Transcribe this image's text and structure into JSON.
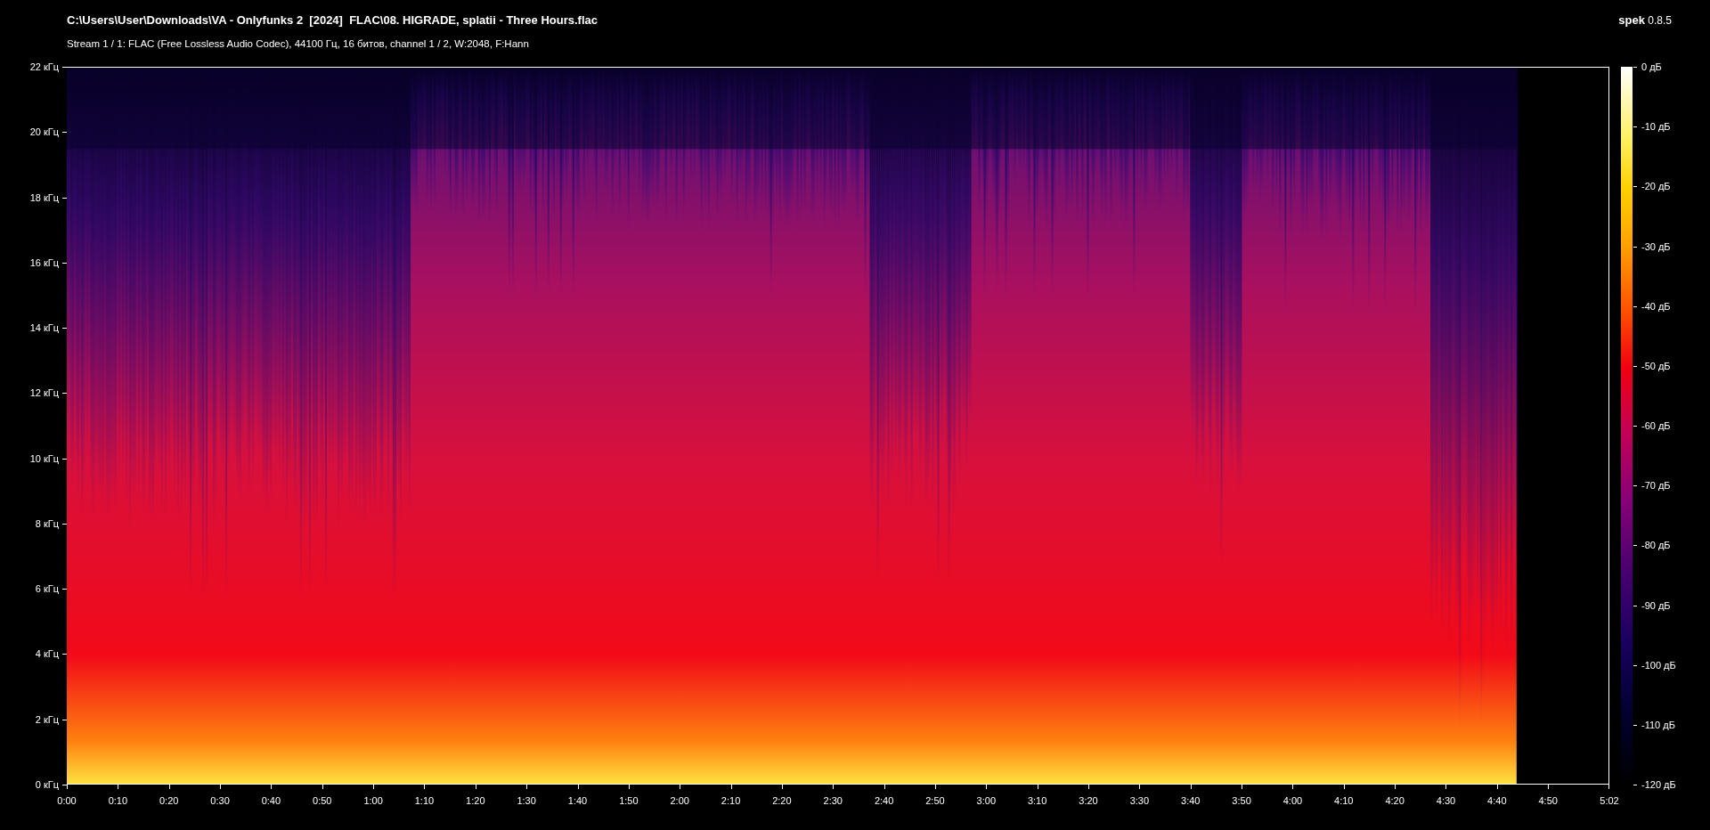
{
  "file_title": "C:\\Users\\User\\Downloads\\VA - Onlyfunks 2  [2024]  FLAC\\08. HIGRADE, splatii - Three Hours.flac",
  "stream_info": "Stream 1 / 1: FLAC (Free Lossless Audio Codec), 44100 Гц, 16 битов, channel 1 / 2, W:2048, F:Hann",
  "app": {
    "name": "spek",
    "version": "0.8.5"
  },
  "frequency_axis": {
    "ticks": [
      "22 кГц",
      "20 кГц",
      "18 кГц",
      "16 кГц",
      "14 кГц",
      "12 кГц",
      "10 кГц",
      "8 кГц",
      "6 кГц",
      "4 кГц",
      "2 кГц",
      "0 кГц"
    ]
  },
  "time_axis": {
    "ticks": [
      "0:00",
      "0:10",
      "0:20",
      "0:30",
      "0:40",
      "0:50",
      "1:00",
      "1:10",
      "1:20",
      "1:30",
      "1:40",
      "1:50",
      "2:00",
      "2:10",
      "2:20",
      "2:30",
      "2:40",
      "2:50",
      "3:00",
      "3:10",
      "3:20",
      "3:30",
      "3:40",
      "3:50",
      "4:00",
      "4:10",
      "4:20",
      "4:30",
      "4:40",
      "4:50",
      "5:02"
    ]
  },
  "level_scale": {
    "ticks": [
      "0 дБ",
      "-10 дБ",
      "-20 дБ",
      "-30 дБ",
      "-40 дБ",
      "-50 дБ",
      "-60 дБ",
      "-70 дБ",
      "-80 дБ",
      "-90 дБ",
      "-100 дБ",
      "-110 дБ",
      "-120 дБ"
    ]
  }
}
